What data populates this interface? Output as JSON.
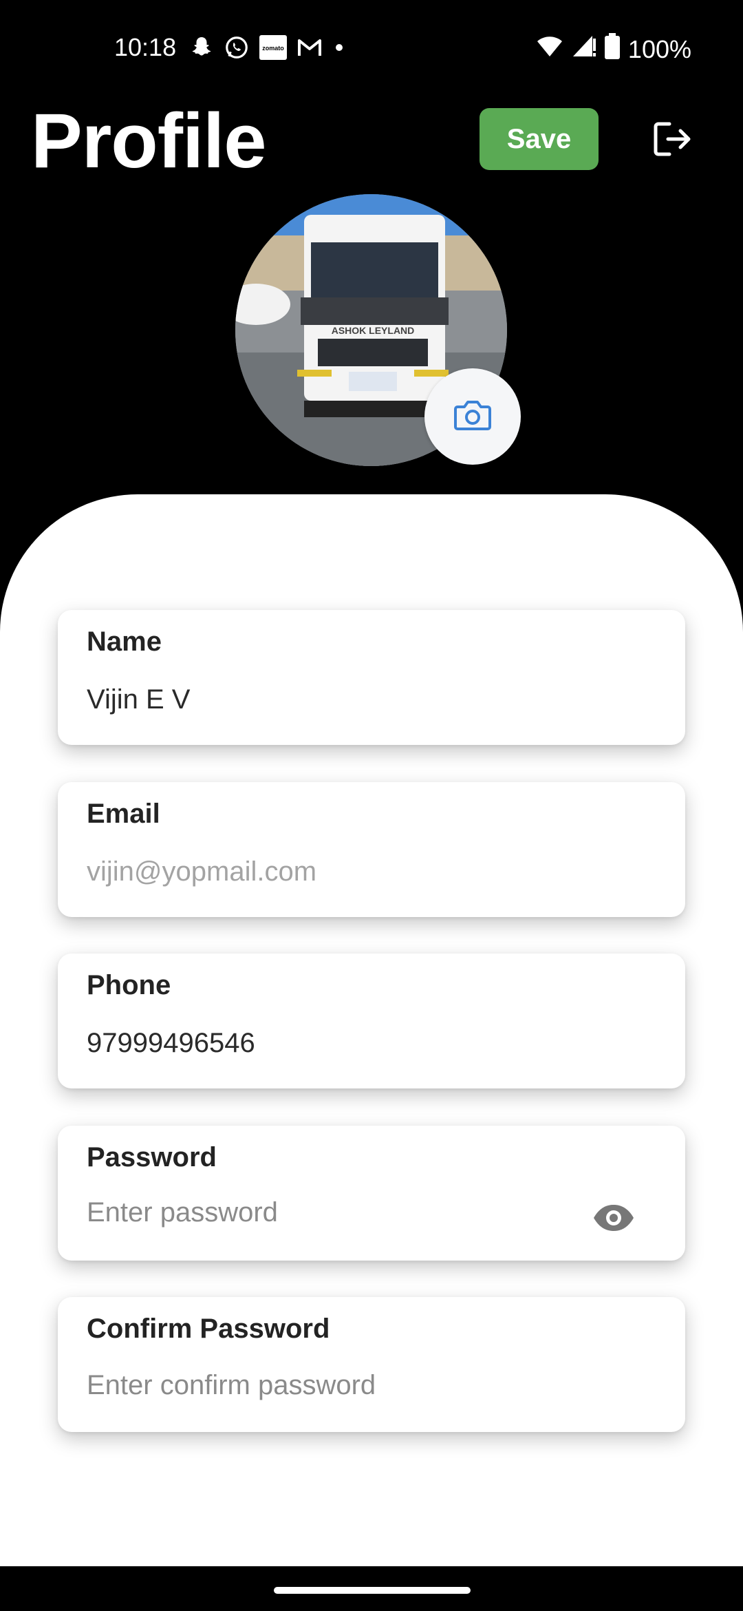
{
  "status_bar": {
    "time": "10:18",
    "notification_icons": [
      "snapchat-icon",
      "whatsapp-icon",
      "zomato-icon",
      "gmail-icon",
      "dot-icon"
    ],
    "zomato_text": "zomato",
    "battery": "100%"
  },
  "header": {
    "title": "Profile",
    "save_label": "Save",
    "logout_icon": "logout-icon"
  },
  "avatar": {
    "camera_icon": "camera-icon",
    "badge_text": "ASHOK LEYLAND"
  },
  "form": {
    "fields": [
      {
        "label": "Name",
        "value": "Vijin E V",
        "placeholder": ""
      },
      {
        "label": "Email",
        "value": "vijin@yopmail.com",
        "placeholder": ""
      },
      {
        "label": "Phone",
        "value": "97999496546",
        "placeholder": ""
      },
      {
        "label": "Password",
        "value": "",
        "placeholder": "Enter password"
      },
      {
        "label": "Confirm Password",
        "value": "",
        "placeholder": "Enter confirm password"
      }
    ]
  },
  "colors": {
    "save_button": "#5aaa54",
    "camera_icon": "#3b82d6",
    "background": "#000000",
    "sheet": "#ffffff"
  }
}
